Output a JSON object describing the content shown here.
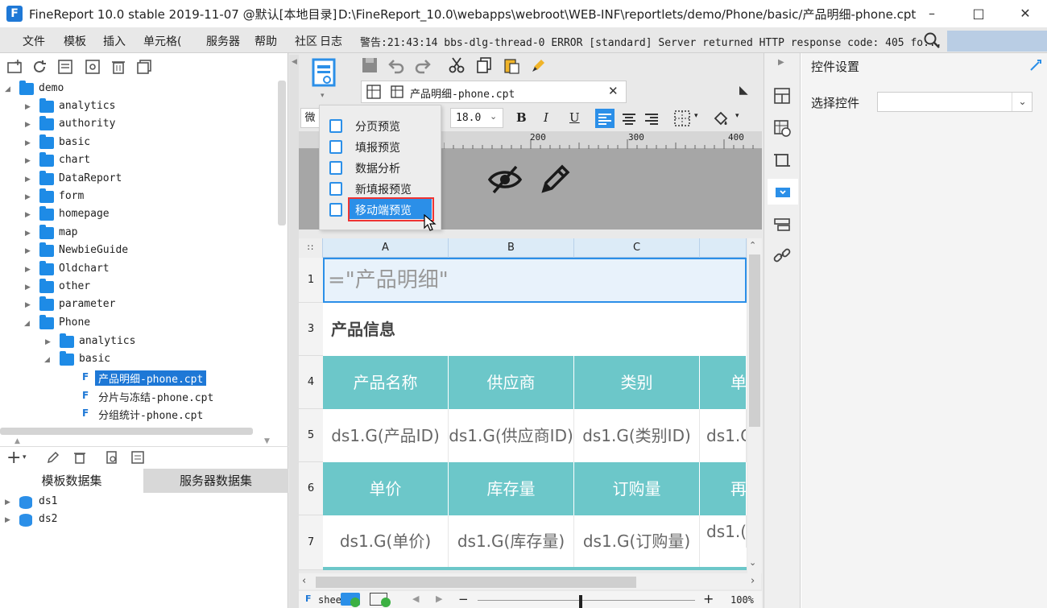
{
  "window": {
    "title": "FineReport 10.0 stable 2019-11-07 @默认[本地目录]",
    "path": "D:\\FineReport_10.0\\webapps\\webroot\\WEB-INF\\reportlets/demo/Phone/basic/产品明细-phone.cpt",
    "logo": "F"
  },
  "menu": {
    "items": [
      "文件",
      "模板",
      "插入",
      "单元格(",
      "服务器",
      "帮助",
      "社区",
      "日志"
    ],
    "warning": "警告:21:43:14 bbs-dlg-thread-0 ERROR [standard] Server returned HTTP response code: 405 fo..."
  },
  "tree": {
    "root": "demo",
    "items": [
      "analytics",
      "authority",
      "basic",
      "chart",
      "DataReport",
      "form",
      "homepage",
      "map",
      "NewbieGuide",
      "Oldchart",
      "other",
      "parameter",
      "Phone"
    ],
    "phone_children": [
      "analytics",
      "basic"
    ],
    "files": [
      "产品明细-phone.cpt",
      "分片与冻结-phone.cpt",
      "分组统计-phone.cpt"
    ]
  },
  "datasets": {
    "tabs": [
      "模板数据集",
      "服务器数据集"
    ],
    "items": [
      "ds1",
      "ds2"
    ]
  },
  "editor": {
    "tab_label": "产品明细-phone.cpt",
    "font_char": "微",
    "font_size": "18.0",
    "ruler_ticks": [
      "200",
      "300",
      "400"
    ],
    "column_headers": [
      "A",
      "B",
      "C"
    ],
    "row_headers": [
      "1",
      "3",
      "4",
      "5",
      "6",
      "7"
    ],
    "formula": "=\"产品明细\"",
    "section_title": "产品信息",
    "header_row1": [
      "产品名称",
      "供应商",
      "类别",
      "单"
    ],
    "data_row1": [
      "ds1.G(产品ID)",
      "ds1.G(供应商ID)",
      "ds1.G(类别ID)",
      "ds1.G"
    ],
    "header_row2": [
      "单价",
      "库存量",
      "订购量",
      "再"
    ],
    "data_row2": [
      "ds1.G(单价)",
      "ds1.G(库存量)",
      "ds1.G(订购量)",
      "ds1.("
    ],
    "sheet_label": "shee",
    "zoom": "100%"
  },
  "preview_menu": {
    "items": [
      "分页预览",
      "填报预览",
      "数据分析",
      "新填报预览",
      "移动端预览"
    ],
    "highlighted": "移动端预览"
  },
  "right_panel": {
    "title": "控件设置",
    "select_label": "选择控件",
    "select_value": ""
  },
  "colors": {
    "accent": "#1e78d6",
    "teal": "#6cc7c9",
    "highlight_border": "#e33333"
  }
}
